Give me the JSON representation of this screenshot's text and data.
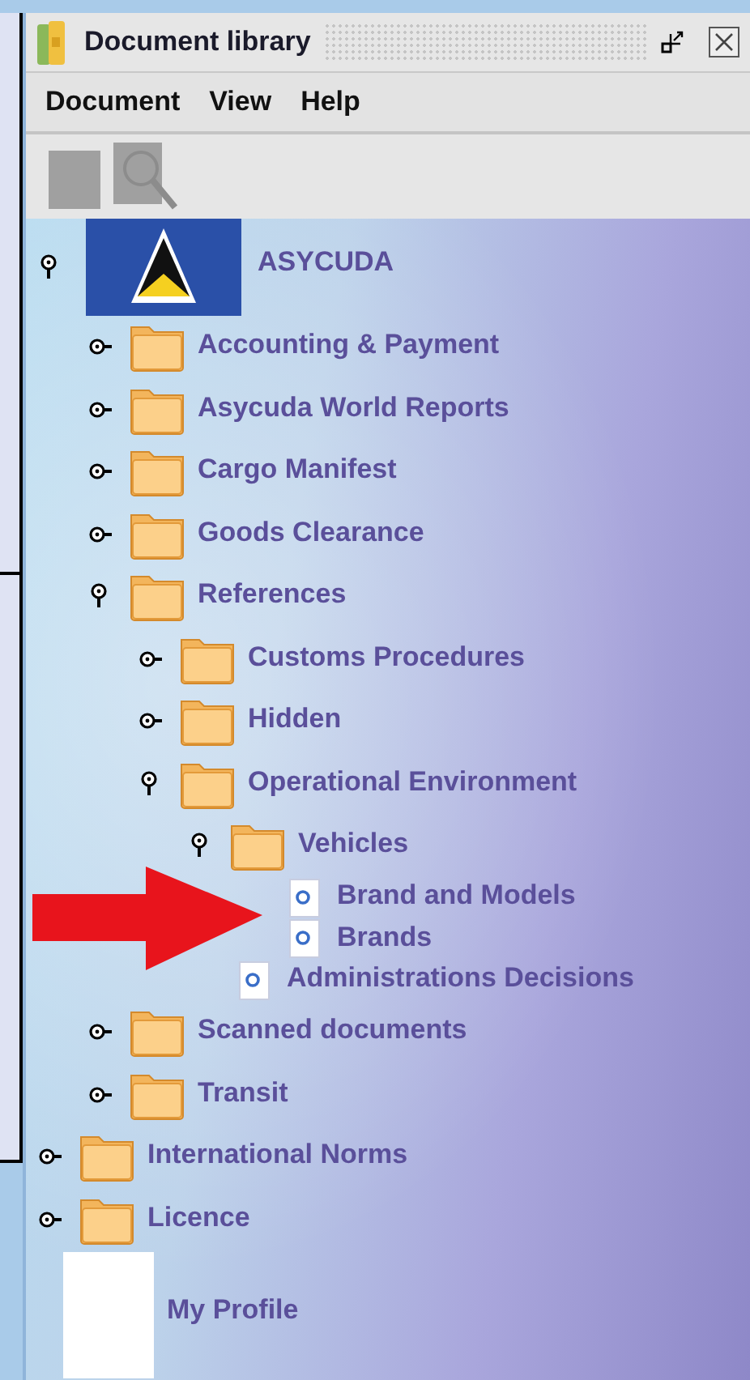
{
  "window": {
    "title": "Document library"
  },
  "menu": [
    "Document",
    "View",
    "Help"
  ],
  "toolbar": [
    {
      "kind": "page",
      "disabled": true
    },
    {
      "kind": "search",
      "disabled": true
    }
  ],
  "tree": [
    {
      "kind": "root",
      "label": "ASYCUDA",
      "expanded": true,
      "children": [
        {
          "kind": "folder",
          "label": "Accounting & Payment",
          "expanded": false
        },
        {
          "kind": "folder",
          "label": "Asycuda World Reports",
          "expanded": false
        },
        {
          "kind": "folder",
          "label": "Cargo Manifest",
          "expanded": false
        },
        {
          "kind": "folder",
          "label": "Goods Clearance",
          "expanded": false
        },
        {
          "kind": "folder",
          "label": "References",
          "expanded": true,
          "children": [
            {
              "kind": "folder",
              "label": "Customs Procedures",
              "expanded": false
            },
            {
              "kind": "folder",
              "label": "Hidden",
              "expanded": false
            },
            {
              "kind": "folder",
              "label": "Operational Environment",
              "expanded": true,
              "children": [
                {
                  "kind": "folder",
                  "label": "Vehicles",
                  "expanded": true,
                  "children": [
                    {
                      "kind": "document",
                      "label": "Brand and Models"
                    },
                    {
                      "kind": "document",
                      "label": "Brands"
                    }
                  ]
                },
                {
                  "kind": "document",
                  "label": "Administrations Decisions"
                }
              ]
            }
          ]
        },
        {
          "kind": "folder",
          "label": "Scanned documents",
          "expanded": false
        },
        {
          "kind": "folder",
          "label": "Transit",
          "expanded": false
        }
      ]
    },
    {
      "kind": "folder",
      "label": "International Norms",
      "expanded": false
    },
    {
      "kind": "folder",
      "label": "Licence",
      "expanded": false
    },
    {
      "kind": "profile",
      "label": "My Profile"
    }
  ]
}
